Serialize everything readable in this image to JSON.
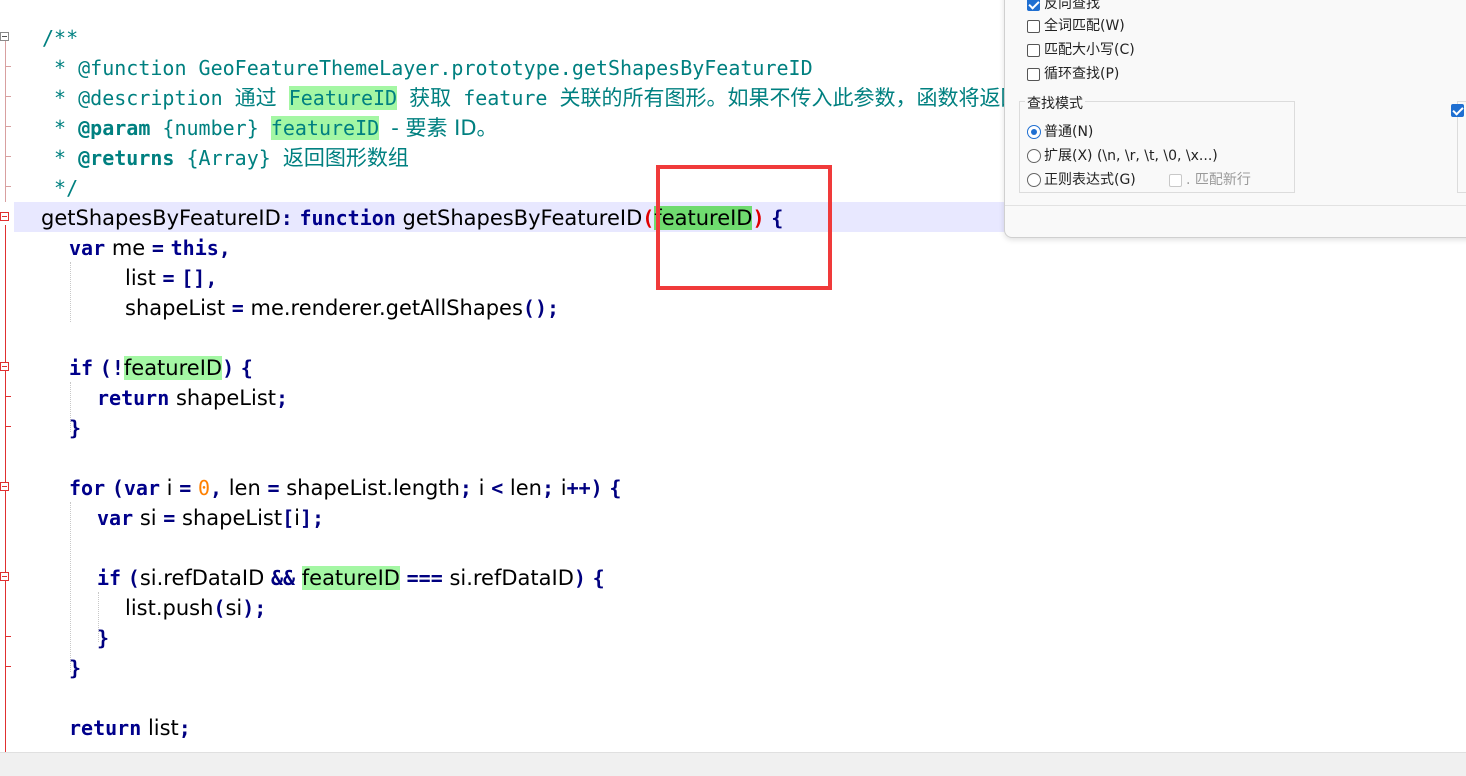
{
  "editor": {
    "comment": {
      "open": "/**",
      "line1_tag": "@function",
      "line1_text": "GeoFeatureThemeLayer.prototype.getShapesByFeatureID",
      "line2_tag": "@description",
      "line2_a": "通过",
      "line2_b": "FeatureID",
      "line2_c": "获取",
      "line2_d": "feature",
      "line2_e": "关联的所有图形。如果不传入此参数，函数将返回所有图形。",
      "line3_tag": "@param",
      "line3_type": "{number}",
      "line3_name": "featureID",
      "line3_rest": "- 要素 ID。",
      "line4_tag": "@returns",
      "line4_type": "{Array}",
      "line4_text": "返回图形数组",
      "close": "*/"
    },
    "code": {
      "fn_name": "getShapesByFeatureID",
      "colon": ":",
      "kw_function": "function",
      "fn_name2": "getShapesByFeatureID",
      "param": "featureID",
      "kw_var": "var",
      "me": "me",
      "kw_this": "this",
      "list": "list",
      "shapeList": "shapeList",
      "renderer_call": "me.renderer.getAllShapes",
      "kw_if": "if",
      "kw_return": "return",
      "kw_for": "for",
      "i": "i",
      "zero": "0",
      "len": "len",
      "shapeList_length": "shapeList.length",
      "si": "si",
      "si_refDataID": "si.refDataID",
      "list_push": "list.push"
    }
  },
  "find_dialog": {
    "reverse_search": "反向查找",
    "whole_word": "全词匹配(W)",
    "match_case": "匹配大小写(C)",
    "wrap_search": "循环查找(P)",
    "search_mode_label": "查找模式",
    "mode_normal": "普通(N)",
    "mode_extended": "扩展(X) (\\n, \\r, \\t, \\0, \\x...)",
    "mode_regex": "正则表达式(G)",
    "dot_newline": ". 匹配新行"
  }
}
